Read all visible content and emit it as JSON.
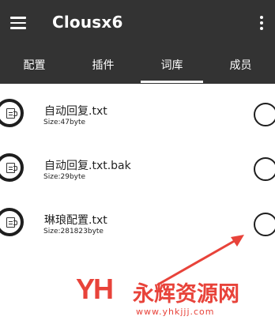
{
  "appbar": {
    "title": "Clousx6",
    "menu_icon": "hamburger-menu-icon",
    "more_icon": "more-vert-icon"
  },
  "tabs": [
    {
      "label": "配置",
      "active": false
    },
    {
      "label": "插件",
      "active": false
    },
    {
      "label": "词库",
      "active": true
    },
    {
      "label": "成员",
      "active": false
    }
  ],
  "files": [
    {
      "name": "自动回复.txt",
      "size": "Size:47byte",
      "icon": "file-icon",
      "selected": false
    },
    {
      "name": "自动回复.txt.bak",
      "size": "Size:29byte",
      "icon": "file-icon",
      "selected": false
    },
    {
      "name": "琳琅配置.txt",
      "size": "Size:281823byte",
      "icon": "file-icon",
      "selected": false
    }
  ],
  "watermark": {
    "logo": "YH",
    "text": "永辉资源网",
    "url": "www.yhkjjj.com",
    "color": "#e8433a"
  },
  "colors": {
    "appbar_bg": "#333333",
    "accent": "#e8433a"
  }
}
